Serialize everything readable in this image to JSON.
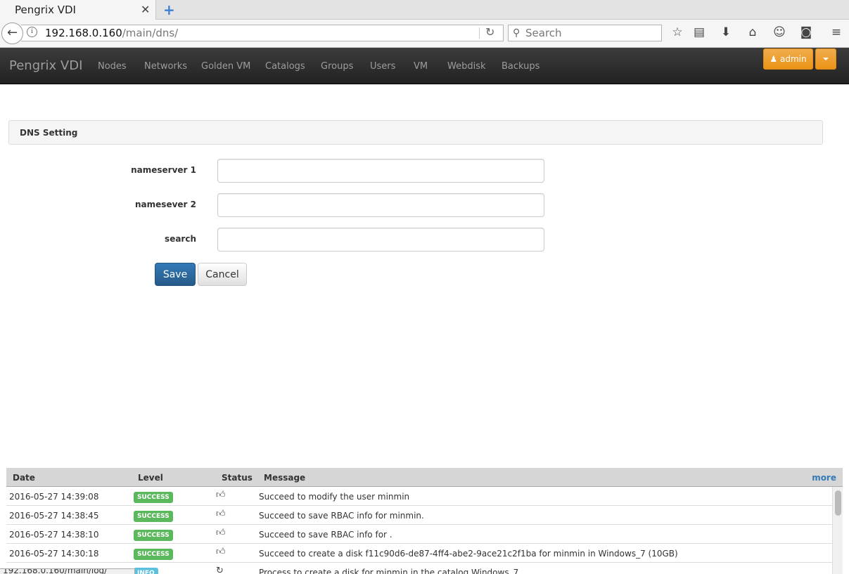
{
  "browser": {
    "tab_title": "Pengrix VDI",
    "tab_close": "✕",
    "new_tab": "+",
    "url_host": "192.168.0.160",
    "url_path": "/main/dns/",
    "search_placeholder": "Search"
  },
  "app": {
    "brand": "Pengrix VDI",
    "nav": [
      "Nodes",
      "Networks",
      "Golden VM",
      "Catalogs",
      "Groups",
      "Users",
      "VM",
      "Webdisk",
      "Backups"
    ],
    "user": "admin"
  },
  "dns": {
    "panel_title": "DNS Setting",
    "fields": [
      {
        "label": "nameserver 1",
        "value": ""
      },
      {
        "label": "namesever 2",
        "value": ""
      },
      {
        "label": "search",
        "value": ""
      }
    ],
    "save_label": "Save",
    "cancel_label": "Cancel"
  },
  "log": {
    "columns": [
      "Date",
      "Level",
      "Status",
      "Message"
    ],
    "more_label": "more",
    "rows": [
      {
        "date": "2016-05-27 14:39:08",
        "level": "SUCCESS",
        "message": "Succeed to modify the user minmin"
      },
      {
        "date": "2016-05-27 14:38:45",
        "level": "SUCCESS",
        "message": "Succeed to save RBAC info for minmin."
      },
      {
        "date": "2016-05-27 14:38:10",
        "level": "SUCCESS",
        "message": "Succeed to save RBAC info for ."
      },
      {
        "date": "2016-05-27 14:30:18",
        "level": "SUCCESS",
        "message": "Succeed to create a disk f11c90d6-de87-4ff4-abe2-9ace21c2f1ba for minmin in Windows_7 (10GB)"
      },
      {
        "date": "",
        "level": "INFO",
        "message": "Process to create a disk for minmin in the catalog Windows_7"
      }
    ]
  },
  "status_overlay": "192.168.0.160/main/log/"
}
